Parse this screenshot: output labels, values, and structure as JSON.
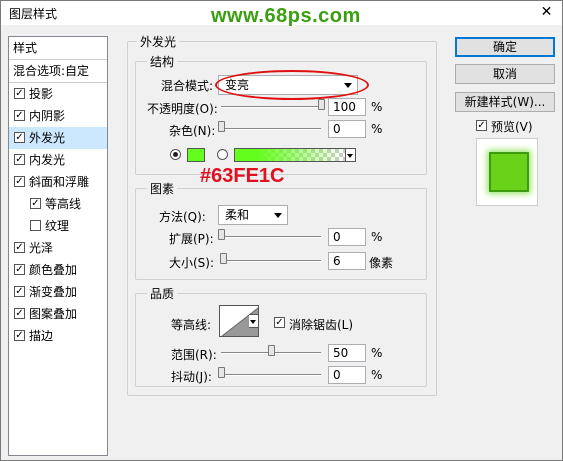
{
  "window": {
    "title": "图层样式",
    "close_glyph": "✕",
    "watermark": "www.68ps.com"
  },
  "stylelist": {
    "header": "样式",
    "blend_options": "混合选项:自定",
    "items": [
      {
        "label": "投影",
        "checked": true
      },
      {
        "label": "内阴影",
        "checked": true
      },
      {
        "label": "外发光",
        "checked": true,
        "selected": true
      },
      {
        "label": "内发光",
        "checked": true
      },
      {
        "label": "斜面和浮雕",
        "checked": true
      },
      {
        "label": "等高线",
        "checked": true,
        "sub": true
      },
      {
        "label": "纹理",
        "checked": false,
        "sub": true
      },
      {
        "label": "光泽",
        "checked": true
      },
      {
        "label": "颜色叠加",
        "checked": true
      },
      {
        "label": "渐变叠加",
        "checked": true
      },
      {
        "label": "图案叠加",
        "checked": true
      },
      {
        "label": "描边",
        "checked": true
      }
    ]
  },
  "outer_glow": {
    "title": "外发光",
    "structure": {
      "legend": "结构",
      "blend_mode_label": "混合模式:",
      "blend_mode_value": "变亮",
      "opacity_label": "不透明度(O):",
      "opacity_value": "100",
      "noise_label": "杂色(N):",
      "noise_value": "0",
      "percent": "%",
      "color_hex": "#63FE1C",
      "opacity_level": 1.0,
      "noise_level": 0.0
    },
    "elements": {
      "legend": "图素",
      "technique_label": "方法(Q):",
      "technique_value": "柔和",
      "spread_label": "扩展(P):",
      "spread_value": "0",
      "size_label": "大小(S):",
      "size_value": "6",
      "size_unit": "像素",
      "percent": "%",
      "spread_level": 0.0,
      "size_level": 0.024
    },
    "quality": {
      "legend": "品质",
      "contour_label": "等高线:",
      "antialias_label": "消除锯齿(L)",
      "antialias_checked": true,
      "range_label": "范围(R):",
      "range_value": "50",
      "jitter_label": "抖动(J):",
      "jitter_value": "0",
      "percent": "%",
      "range_level": 0.5,
      "jitter_level": 0.0
    }
  },
  "buttons": {
    "ok": "确定",
    "cancel": "取消",
    "new_style": "新建样式(W)..."
  },
  "preview": {
    "label": "预览(V)",
    "checked": true
  },
  "annotation": {
    "color_code": "#63FE1C"
  }
}
